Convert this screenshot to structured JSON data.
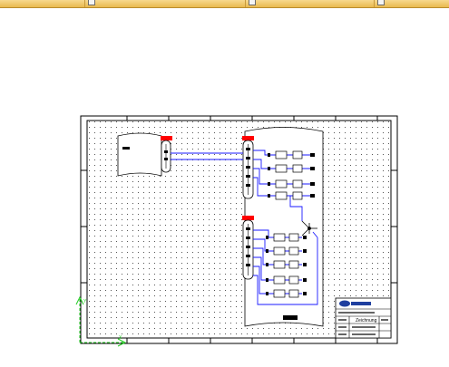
{
  "window": {
    "title": ""
  },
  "toolbar": {
    "buttons": [
      {
        "icon": "checkbox-icon"
      },
      {
        "icon": "checkbox-icon"
      },
      {
        "icon": "checkbox-icon"
      }
    ]
  },
  "drawing": {
    "title_block_name": "Zeichnung",
    "ucs_labels": {
      "y": "Y",
      "x": "X"
    },
    "colors": {
      "frame": "#000000",
      "wire": "#1a1aff",
      "terminal_head": "#ff0000",
      "ucs": "#22cc22",
      "logo": "#1f3f9f"
    }
  }
}
